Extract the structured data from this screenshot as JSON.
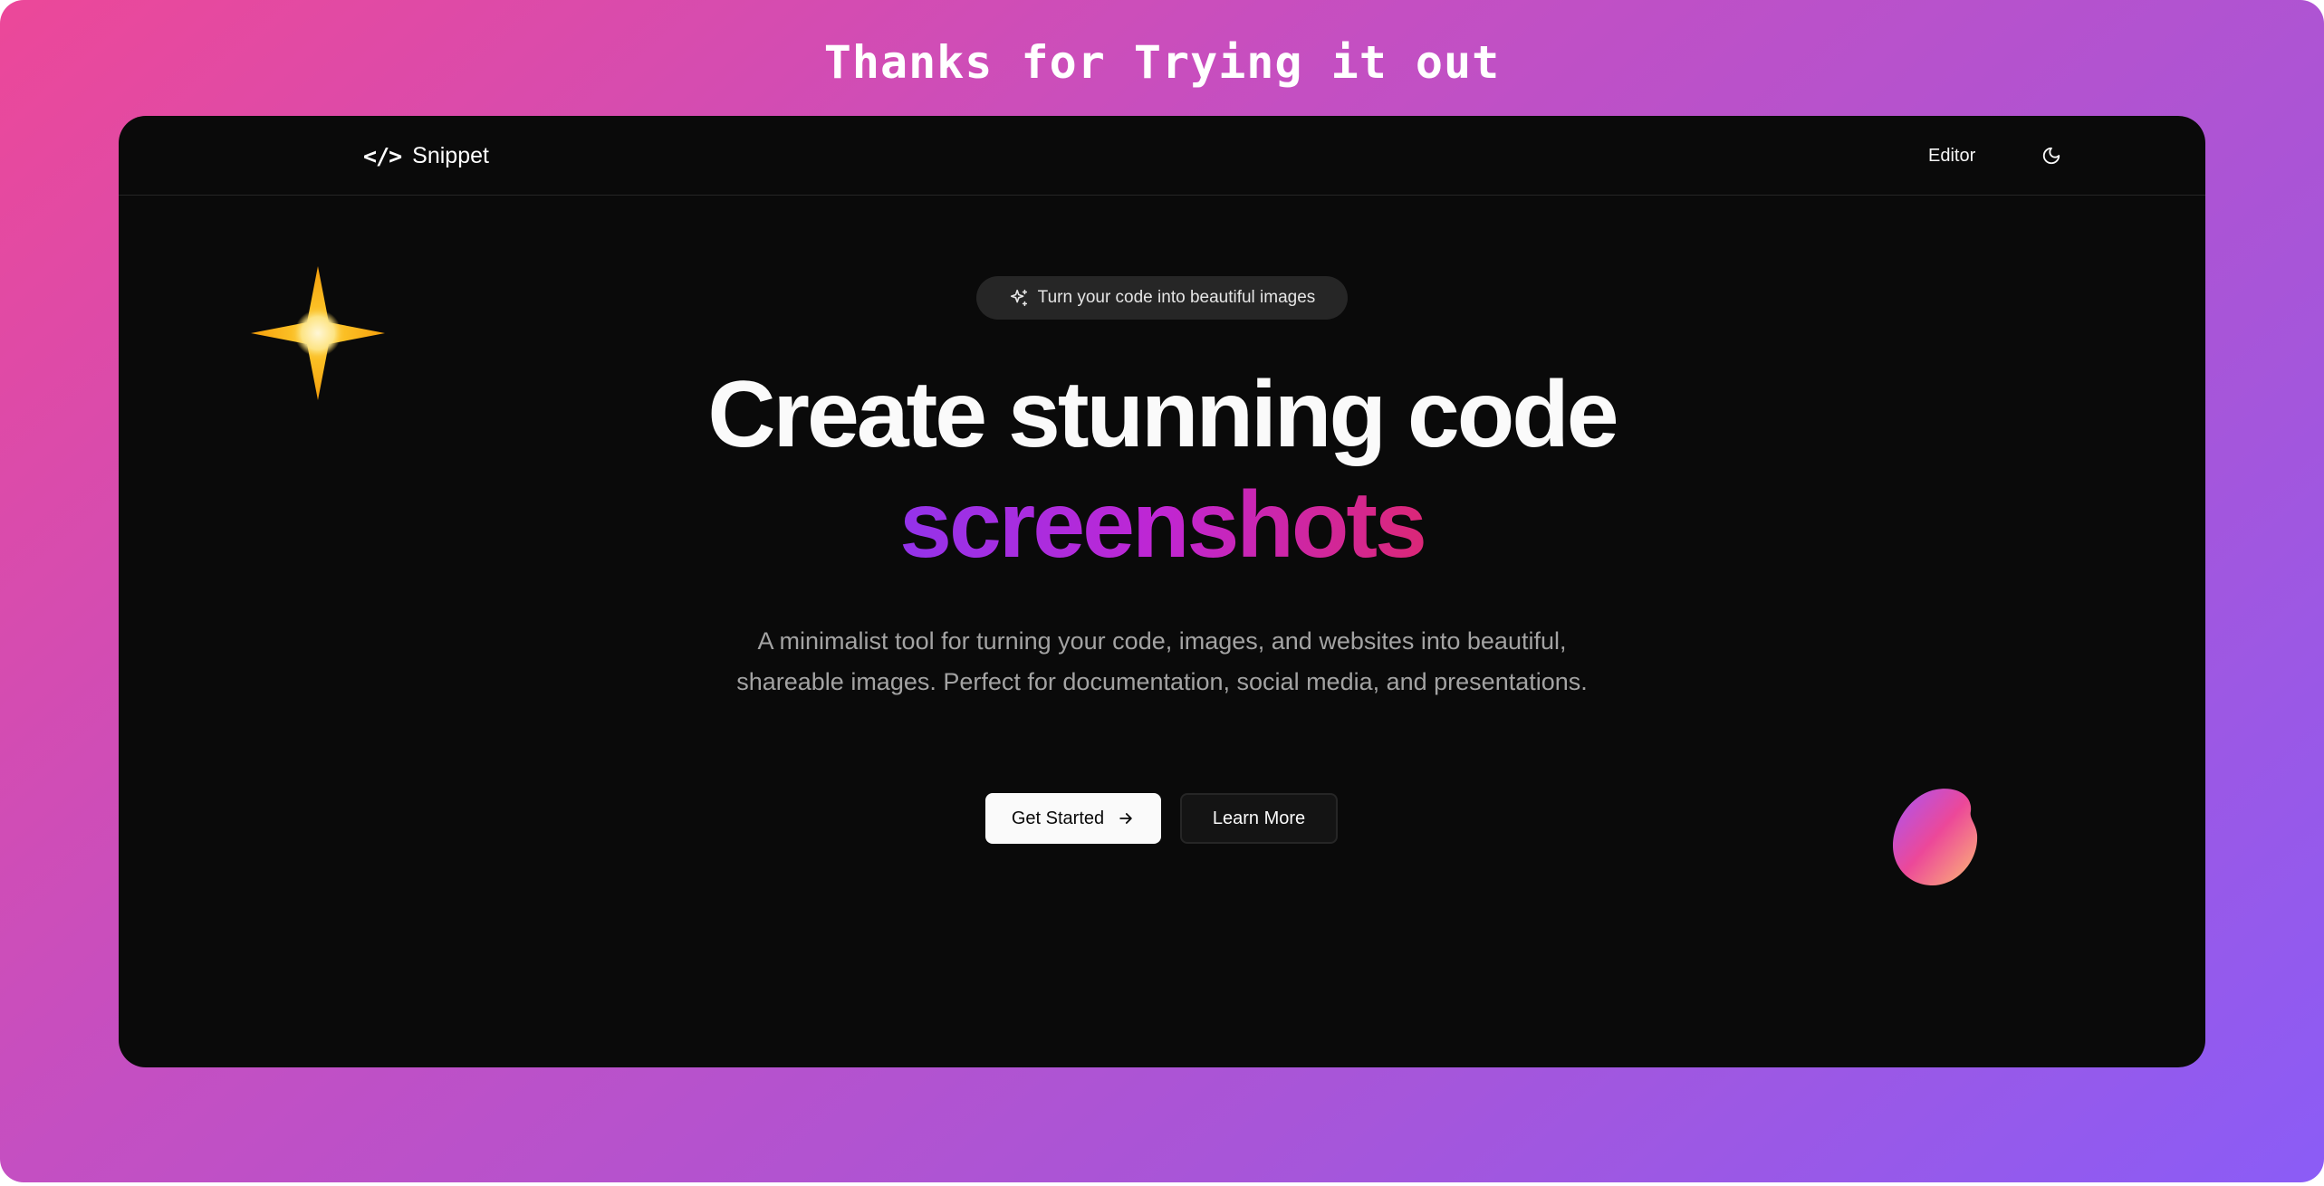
{
  "banner": {
    "title": "Thanks for Trying it out"
  },
  "navbar": {
    "brand_mark": "</>",
    "brand_name": "Snippet",
    "editor_link": "Editor",
    "theme_icon": "moon-icon"
  },
  "hero": {
    "pill_icon": "sparkles-icon",
    "pill_text": "Turn your code into beautiful images",
    "headline": "Create stunning code",
    "headline_accent": "screenshots",
    "description": "A minimalist tool for turning your code, images, and websites into beautiful, shareable images. Perfect for documentation, social media, and presentations.",
    "primary_button": "Get Started",
    "primary_button_icon": "arrow-right-icon",
    "secondary_button": "Learn More",
    "decorations": [
      "four-point-star-icon",
      "gradient-blob"
    ]
  },
  "colors": {
    "backdrop_start": "#ec4899",
    "backdrop_end": "#8b5cf6",
    "window_background": "#0a0a0a",
    "accent_gradient": [
      "#9333ea",
      "#c026d3",
      "#db2777"
    ],
    "star": "#f59e0b"
  }
}
